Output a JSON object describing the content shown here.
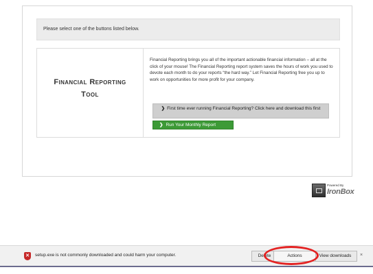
{
  "prompt": {
    "text": "Please select one of the buttons listed below."
  },
  "tool": {
    "title_line1": "Financial Reporting",
    "title_line2": "Tool",
    "description": "Financial Reporting brings you all of the important actionable financial information – all at the click of your mouse! The Financial Reporting report system saves the hours of work you used to devote each month to do your reports “the hard way.” Let Financial Reporting free you up to work on opportunities for more profit for your company."
  },
  "buttons": {
    "first_time_label": "First time ever running Financial Reporting? Click here and download this first",
    "run_label": "Run Your Monthly Report"
  },
  "logo": {
    "powered_by": "Powered By",
    "name": "IronBox"
  },
  "download_bar": {
    "message": "setup.exe is not commonly downloaded and could harm your computer.",
    "delete_label": "Delete",
    "actions_label": "Actions",
    "view_downloads_label": "View downloads",
    "close_glyph": "×"
  },
  "colors": {
    "run_button": "#3d9a37",
    "highlight_ring": "#e32222",
    "warning_icon": "#c62828"
  }
}
